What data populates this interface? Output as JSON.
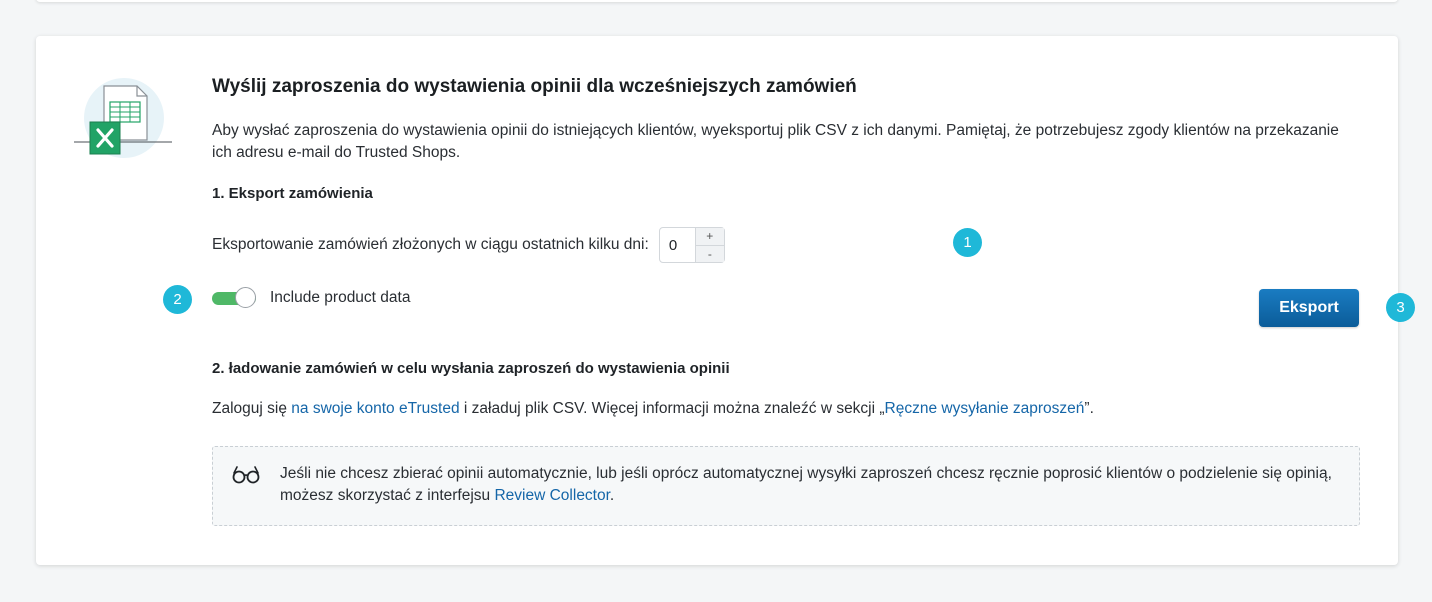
{
  "section": {
    "title": "Wyślij zaproszenia do wystawienia opinii dla wcześniejszych zamówień",
    "description": "Aby wysłać zaproszenia do wystawienia opinii do istniejących klientów, wyeksportuj plik CSV z ich danymi. Pamiętaj, że potrzebujesz zgody klientów na przekazanie ich adresu e-mail do Trusted Shops."
  },
  "step1": {
    "title": "1. Eksport zamówienia",
    "days_label": "Eksportowanie zamówień złożonych w ciągu ostatnich kilku dni:",
    "days_value": "0",
    "increment_label": "+",
    "decrement_label": "-",
    "include_product_label": "Include product data",
    "include_product_enabled": true,
    "export_button_label": "Eksport"
  },
  "badges": {
    "one": "1",
    "two": "2",
    "three": "3",
    "color": "#1fb8d8"
  },
  "step2": {
    "title": "2. ładowanie zamówień w celu wysłania zaproszeń do wystawienia opinii",
    "text_before_link": "Zaloguj się ",
    "account_link": "na swoje konto eTrusted",
    "text_middle": " i załaduj plik CSV. Więcej informacji można znaleźć w sekcji „",
    "manual_link": "Ręczne wysyłanie zaproszeń",
    "text_after": "”."
  },
  "info": {
    "icon": "glasses-icon",
    "text": "Jeśli nie chcesz zbierać opinii automatycznie, lub jeśli oprócz automatycznej wysyłki zaproszeń chcesz ręcznie poprosić klientów o podzielenie się opinią, możesz skorzystać z interfejsu ",
    "link": "Review Collector",
    "text_after": "."
  },
  "colors": {
    "accent": "#1566a8",
    "button": "#0f6db0",
    "toggle_on": "#4fb867",
    "excel_green": "#21a366"
  }
}
